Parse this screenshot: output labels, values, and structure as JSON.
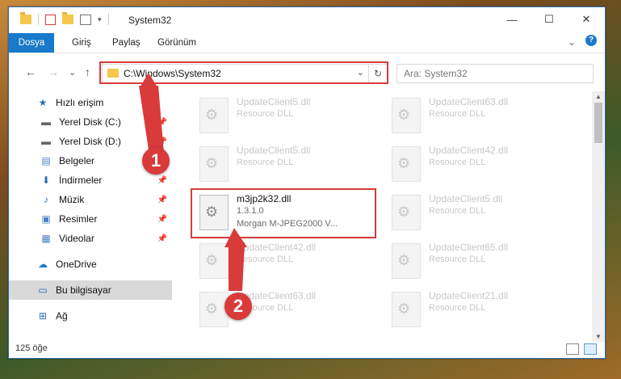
{
  "window": {
    "title": "System32",
    "minimize": "—",
    "maximize": "☐",
    "close": "✕"
  },
  "ribbon": {
    "tabs": [
      "Dosya",
      "Giriş",
      "Paylaş",
      "Görünüm"
    ],
    "collapse": "⌄",
    "help": "?"
  },
  "nav": {
    "back": "←",
    "forward": "→",
    "recent": "⌄",
    "up": "↑",
    "address": "C:\\Windows\\System32",
    "dropdown": "⌄",
    "refresh": "↻",
    "search_placeholder": "Ara: System32"
  },
  "sidebar": {
    "items": [
      {
        "label": "Hızlı erişim",
        "icon": "star-icon",
        "glyph": "★",
        "color": "#2b6cb0"
      },
      {
        "label": "Yerel Disk (C:)",
        "icon": "drive-icon",
        "glyph": "▬",
        "pin": true
      },
      {
        "label": "Yerel Disk (D:)",
        "icon": "drive-icon",
        "glyph": "▬",
        "pin": true
      },
      {
        "label": "Belgeler",
        "icon": "document-icon",
        "glyph": "▤",
        "pin": true
      },
      {
        "label": "İndirmeler",
        "icon": "download-icon",
        "glyph": "⬇",
        "pin": true
      },
      {
        "label": "Müzik",
        "icon": "music-icon",
        "glyph": "♪",
        "pin": true
      },
      {
        "label": "Resimler",
        "icon": "pictures-icon",
        "glyph": "▣",
        "pin": true
      },
      {
        "label": "Videolar",
        "icon": "video-icon",
        "glyph": "▦",
        "pin": true
      },
      {
        "label": "OneDrive",
        "icon": "cloud-icon",
        "glyph": "☁"
      },
      {
        "label": "Bu bilgisayar",
        "icon": "computer-icon",
        "glyph": "▭"
      },
      {
        "label": "Ağ",
        "icon": "network-icon",
        "glyph": "⊞"
      }
    ]
  },
  "files": [
    {
      "name": "UpdateClient5.dll",
      "meta": "Resource DLL",
      "meta2": ""
    },
    {
      "name": "UpdateClient63.dll",
      "meta": "Resource DLL",
      "meta2": ""
    },
    {
      "name": "UpdateClient5.dll",
      "meta": "Resource DLL",
      "meta2": ""
    },
    {
      "name": "UpdateClient42.dll",
      "meta": "Resource DLL",
      "meta2": ""
    },
    {
      "name": "m3jp2k32.dll",
      "meta": "1.3.1.0",
      "meta2": "Morgan M-JPEG2000 V...",
      "focus": true
    },
    {
      "name": "UpdateClient5.dll",
      "meta": "Resource DLL",
      "meta2": ""
    },
    {
      "name": "UpdateClient42.dll",
      "meta": "Resource DLL",
      "meta2": ""
    },
    {
      "name": "UpdateClient65.dll",
      "meta": "Resource DLL",
      "meta2": ""
    },
    {
      "name": "UpdateClient63.dll",
      "meta": "Resource DLL",
      "meta2": ""
    },
    {
      "name": "UpdateClient21.dll",
      "meta": "Resource DLL",
      "meta2": ""
    }
  ],
  "status": {
    "count": "125 öğe"
  },
  "markers": [
    "1",
    "2"
  ],
  "colors": {
    "accent": "#1979ca",
    "highlight": "#d93a3a"
  }
}
